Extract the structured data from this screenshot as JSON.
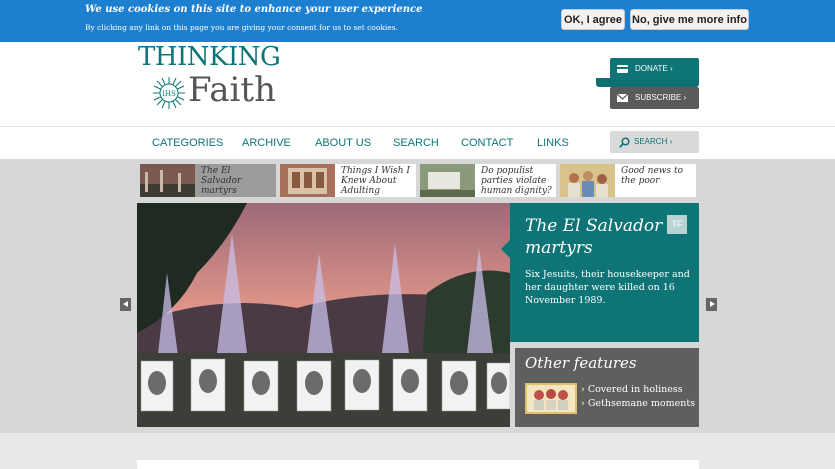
{
  "cookie": {
    "title": "We use cookies on this site to enhance your user experience",
    "text": "By clicking any link on this page you are giving your consent for us to set cookies.",
    "ok_label": "OK, I agree",
    "info_label": "No, give me more info"
  },
  "logo": {
    "line1": "THINKING",
    "line2": "Faith",
    "emblem": "IHS"
  },
  "header": {
    "donate_label": "DONATE ›",
    "subscribe_label": "SUBSCRIBE ›"
  },
  "nav": {
    "items": [
      "CATEGORIES",
      "ARCHIVE",
      "ABOUT US",
      "SEARCH",
      "CONTACT",
      "LINKS"
    ],
    "search_label": "SEARCH ›"
  },
  "thumbs": [
    {
      "title": "The El Salvador martyrs",
      "active": true
    },
    {
      "title": "Things I Wish I Knew About Adulting",
      "active": false
    },
    {
      "title": "Do populist parties violate human dignity?",
      "active": false
    },
    {
      "title": "Good news to the poor",
      "active": false
    }
  ],
  "feature": {
    "title": "The El Salvador martyrs",
    "badge": "TF",
    "description": "Six Jesuits, their housekeeper and her daughter were killed on 16 November 1989."
  },
  "other": {
    "title": "Other features",
    "items": [
      "› Covered in holiness",
      "› Gethsemane moments"
    ]
  },
  "colors": {
    "brand_teal": "#0e7476",
    "cookie_blue": "#1d7fd0",
    "dark_grey": "#5f5f5f"
  },
  "icons": {
    "donate": "card-icon",
    "subscribe": "envelope-icon",
    "search": "magnifier-icon"
  }
}
